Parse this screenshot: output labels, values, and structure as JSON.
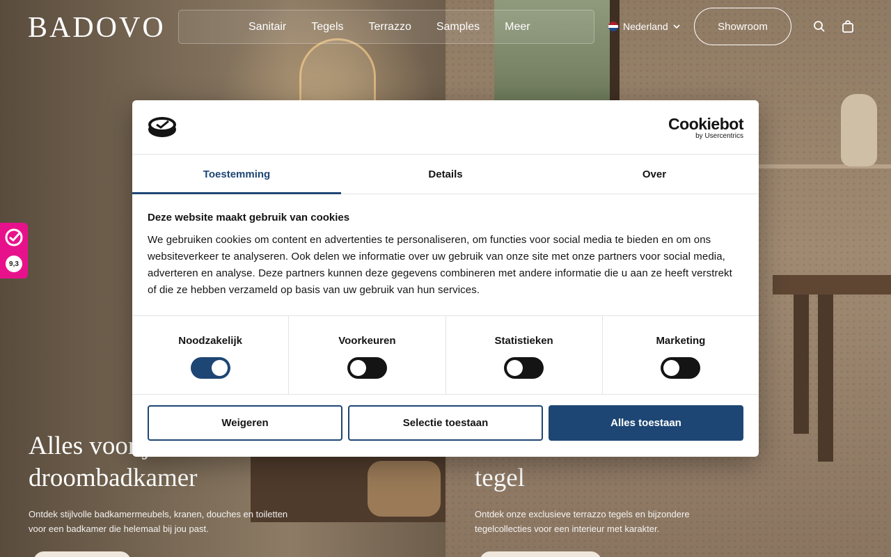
{
  "header": {
    "logo": "BADOVO",
    "nav": [
      "Sanitair",
      "Tegels",
      "Terrazzo",
      "Samples",
      "Meer"
    ],
    "language": "Nederland",
    "showroom_label": "Showroom"
  },
  "hero": {
    "left_title_line1": "Alles voor je",
    "left_title_line2": "droombadkamer",
    "left_sub": "Ontdek stijlvolle badkamermeubels, kranen, douches en toiletten voor een badkamer die helemaal bij jou past.",
    "right_title_line1": "",
    "right_title_line2": "tegel",
    "right_sub": "Ontdek onze exclusieve terrazzo tegels en bijzondere tegelcollecties voor een interieur met karakter."
  },
  "badge": {
    "score": "9,3"
  },
  "cookie": {
    "brand_main": "Cookiebot",
    "brand_sub": "by Usercentrics",
    "tabs": [
      "Toestemming",
      "Details",
      "Over"
    ],
    "active_tab": "Toestemming",
    "heading": "Deze website maakt gebruik van cookies",
    "body": "We gebruiken cookies om content en advertenties te personaliseren, om functies voor social media te bieden en om ons websiteverkeer te analyseren. Ook delen we informatie over uw gebruik van onze site met onze partners voor social media, adverteren en analyse. Deze partners kunnen deze gegevens combineren met andere informatie die u aan ze heeft verstrekt of die ze hebben verzameld op basis van uw gebruik van hun services.",
    "categories": [
      {
        "label": "Noodzakelijk",
        "enabled": true
      },
      {
        "label": "Voorkeuren",
        "enabled": false
      },
      {
        "label": "Statistieken",
        "enabled": false
      },
      {
        "label": "Marketing",
        "enabled": false
      }
    ],
    "buttons": {
      "deny": "Weigeren",
      "selection": "Selectie toestaan",
      "allow_all": "Alles toestaan"
    }
  },
  "colors": {
    "accent": "#1e4674",
    "badge": "#e8118c"
  }
}
